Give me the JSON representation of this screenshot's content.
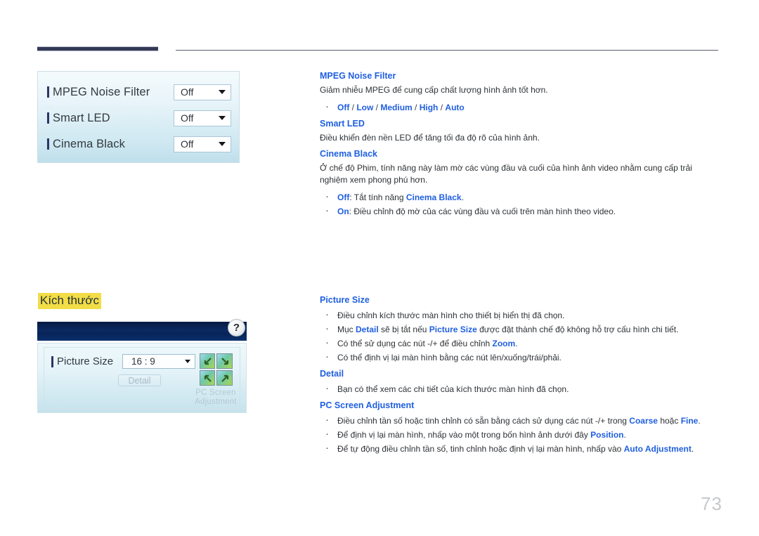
{
  "page": {
    "number": "73"
  },
  "section_heading": {
    "label": "Kích thước",
    "highlight_color": "#f2dd46"
  },
  "colors": {
    "accent_blue": "#1f5fe0",
    "header_bar": "#343a56",
    "titlebar_blue": "#0b2a63"
  },
  "panel_picture_options": {
    "rows": [
      {
        "label": "MPEG Noise Filter",
        "value": "Off"
      },
      {
        "label": "Smart LED",
        "value": "Off"
      },
      {
        "label": "Cinema Black",
        "value": "Off"
      }
    ]
  },
  "panel_picture_size": {
    "help_label": "?",
    "row": {
      "label": "Picture Size",
      "value": "16 : 9"
    },
    "detail_button": "Detail",
    "pc_screen_adjustment_label_line1": "PC Screen",
    "pc_screen_adjustment_label_line2": "Adjustment"
  },
  "sections": [
    {
      "heading": "MPEG Noise Filter",
      "paragraph": "Giảm nhiễu MPEG để cung cấp chất lượng hình ảnh tốt hơn.",
      "options_line": {
        "items": [
          "Off",
          "Low",
          "Medium",
          "High",
          "Auto"
        ],
        "separator": " / "
      }
    },
    {
      "heading": "Smart LED",
      "paragraph": "Điều khiển đèn nền LED để tăng tối đa độ rõ của hình ảnh."
    },
    {
      "heading": "Cinema Black",
      "paragraph": "Ở chế độ Phim, tính năng này làm mờ các vùng đầu và cuối của hình ảnh video nhằm cung cấp trải nghiệm xem phong phú hơn.",
      "bullets": [
        {
          "lead": "Off",
          "text": ": Tắt tính năng ",
          "link": "Cinema Black",
          "tail": "."
        },
        {
          "lead": "On",
          "text": ": Điều chỉnh độ mờ của các vùng đầu và cuối trên màn hình theo video."
        }
      ]
    },
    {
      "heading": "Picture Size",
      "bullets": [
        {
          "text": "Điều chỉnh kích thước màn hình cho thiết bị hiển thị đã chọn."
        },
        {
          "pre": "Mục ",
          "link1": "Detail",
          "mid": " sẽ bị tắt nếu ",
          "link2": "Picture Size",
          "post": " được đặt thành chế độ không hỗ trợ cấu hình chi tiết."
        },
        {
          "pre": "Có thể sử dụng các nút -/+ để điều chỉnh ",
          "link1": "Zoom",
          "post": "."
        },
        {
          "text": "Có thể định vị lại màn hình bằng các nút lên/xuống/trái/phải."
        }
      ]
    },
    {
      "heading": "Detail",
      "bullets": [
        {
          "text": "Bạn có thể xem các chi tiết của kích thước màn hình đã chọn."
        }
      ]
    },
    {
      "heading": "PC Screen Adjustment",
      "bullets": [
        {
          "pre": "Điều chỉnh tần số hoặc tinh chỉnh có sẵn bằng cách sử dụng các nút -/+ trong ",
          "link1": "Coarse",
          "mid": " hoặc ",
          "link2": "Fine",
          "post": "."
        },
        {
          "pre": "Để định vị lại màn hình, nhấp vào một trong bốn hình ảnh dưới đây ",
          "link1": "Position",
          "post": "."
        },
        {
          "pre": "Để tự động điều chỉnh tần số, tinh chỉnh hoặc định vị lại màn hình, nhấp vào ",
          "link1": "Auto Adjustment",
          "post": "."
        }
      ]
    }
  ]
}
